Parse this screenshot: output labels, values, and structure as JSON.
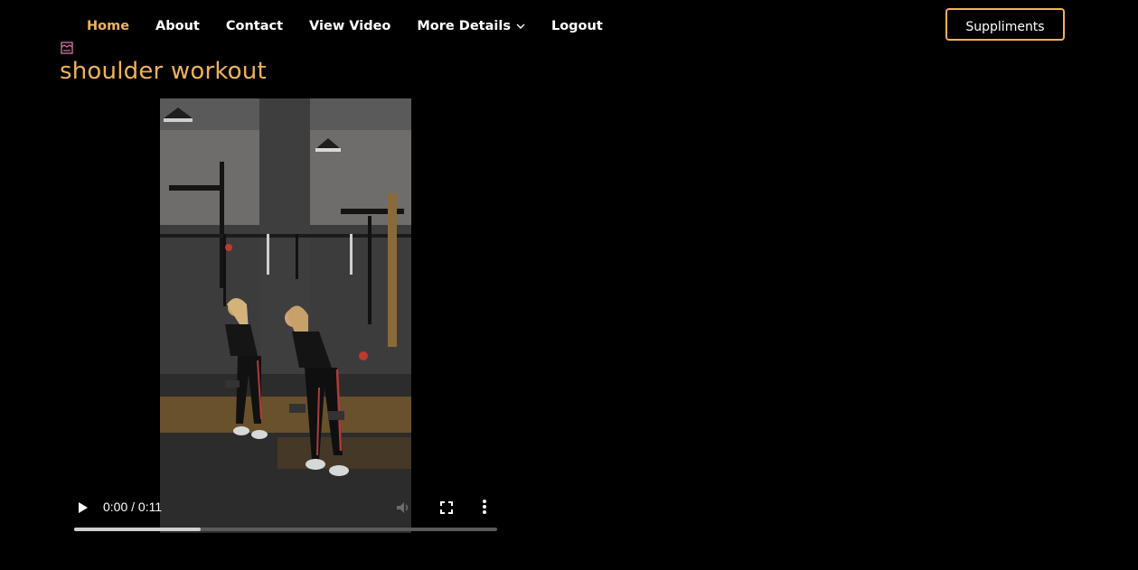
{
  "nav": {
    "items": [
      {
        "label": "Home",
        "active": true
      },
      {
        "label": "About"
      },
      {
        "label": "Contact"
      },
      {
        "label": "View Video"
      },
      {
        "label": "More Details"
      },
      {
        "label": "Logout"
      }
    ],
    "cta_label": "Suppliments"
  },
  "page": {
    "title": "shoulder workout"
  },
  "video": {
    "time": "0:00 / 0:11",
    "progress_fraction": 0.3,
    "icons": [
      "play-icon",
      "volume-icon",
      "fullscreen-icon",
      "more-options-icon"
    ]
  },
  "colors": {
    "accent": "#f0b35a",
    "background": "#000000"
  }
}
